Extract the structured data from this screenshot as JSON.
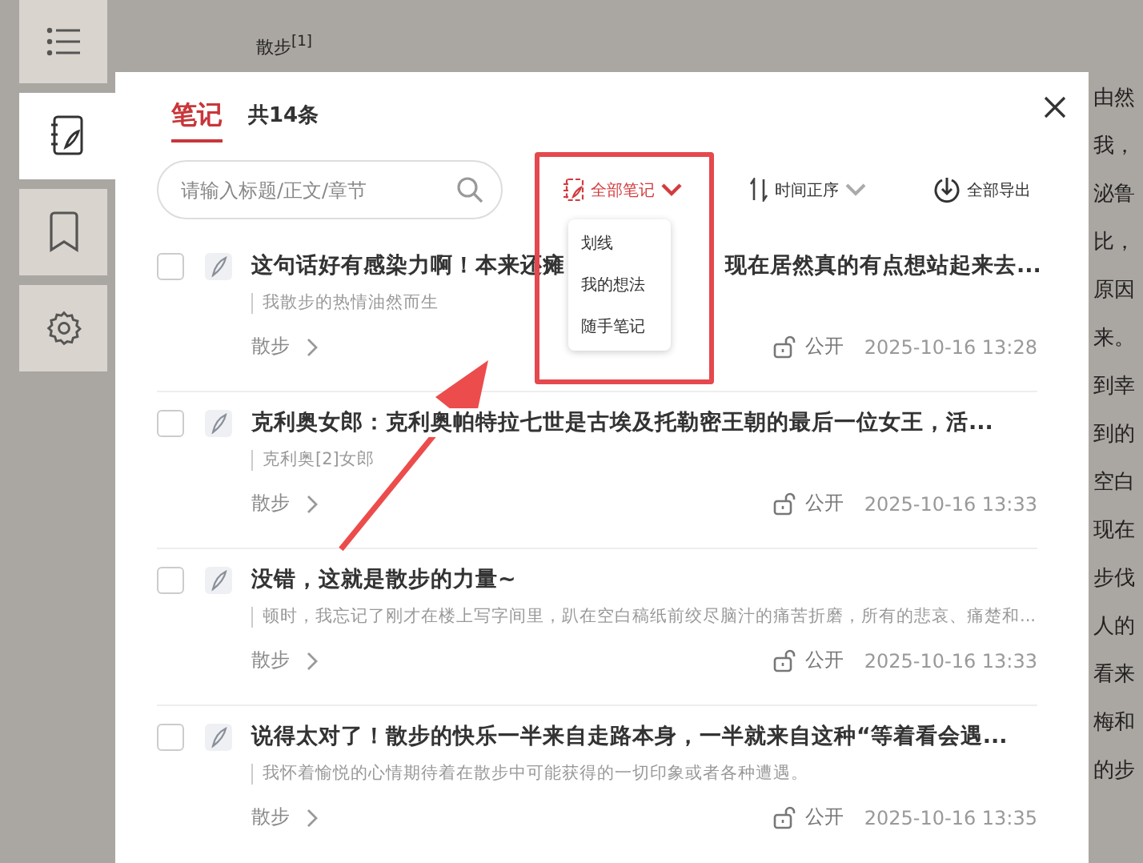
{
  "sidebar": {
    "items": [
      {
        "kind": "contents",
        "selected": false
      },
      {
        "kind": "notes",
        "selected": true
      },
      {
        "kind": "bookmarks",
        "selected": false
      },
      {
        "kind": "settings",
        "selected": false
      }
    ]
  },
  "page": {
    "chapter_title": "散步$^{[1]}$",
    "fragments": [
      "由然",
      "我，",
      "泌鲁",
      "比，",
      "原因",
      "来。",
      "到幸",
      "到的",
      "空白",
      "现在",
      "步伐",
      "人的",
      "看来",
      "梅和",
      "的步"
    ]
  },
  "notes_panel": {
    "tabs": [
      {
        "label": "笔记",
        "selected": true
      }
    ],
    "count": "共14条",
    "search": {
      "placeholder": "请输入标题/正文/章节"
    },
    "filter": {
      "label": "全部笔记",
      "expanded": true,
      "options": [
        "划线",
        "我的想法",
        "随手笔记"
      ]
    },
    "sort": {
      "label": "时间正序"
    },
    "export": {
      "label": "全部导出"
    },
    "notes": [
      {
        "checked": false,
        "title": [
          "这句话好有感染力啊！本来还瘫",
          "现在居然真的有点想站起来去..."
        ],
        "quote": "我散步的热情油然而生",
        "chapter": "散步",
        "visibility": "公开",
        "date": "2025-10-16 13:28"
      },
      {
        "checked": false,
        "title": [
          "克利奥女郎：克利奥帕特拉七世是古埃及托勒密王朝的最后一位女王，活..."
        ],
        "quote": "克利奥[2]女郎",
        "chapter": "散步",
        "visibility": "公开",
        "date": "2025-10-16 13:33"
      },
      {
        "checked": false,
        "title": [
          "没错，这就是散步的力量~"
        ],
        "quote": "顿时，我忘记了刚才在楼上写字间里，趴在空白稿纸前绞尽脑汁的痛苦折磨，所有的悲哀、痛楚和...",
        "chapter": "散步",
        "visibility": "公开",
        "date": "2025-10-16 13:33"
      },
      {
        "checked": false,
        "title": [
          "说得太对了！散步的快乐一半来自走路本身，一半就来自这种“等着看会遇..."
        ],
        "quote": "我怀着愉悦的心情期待着在散步中可能获得的一切印象或者各种遭遇。",
        "chapter": "散步",
        "visibility": "公开",
        "date": "2025-10-16 13:35"
      }
    ]
  }
}
